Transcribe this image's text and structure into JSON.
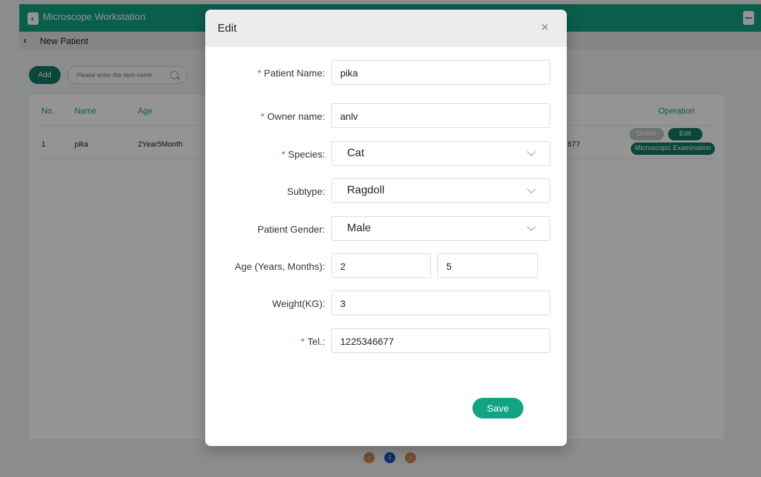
{
  "app": {
    "title": "Microscope Workstation",
    "breadcrumb": "New Patient"
  },
  "toolbar": {
    "add_label": "Add",
    "search_placeholder": "Please enter the item name"
  },
  "table": {
    "headers": {
      "no": "No.",
      "name": "Name",
      "age": "Age",
      "operation": "Operation"
    },
    "row": {
      "no": "1",
      "name": "pika",
      "age": "2Year5Month",
      "tel_partial": "677",
      "delete_label": "Delete",
      "edit_label": "Edit",
      "exam_label": "Microscopic Examination"
    }
  },
  "pagination": {
    "prev": "‹",
    "current": "1",
    "next": "›"
  },
  "modal": {
    "title": "Edit",
    "close_glyph": "×",
    "required_mark": "*",
    "labels": {
      "patient_name": "Patient Name:",
      "owner_name": "Owner name:",
      "species": "Species:",
      "subtype": "Subtype:",
      "gender": "Patient Gender:",
      "age": "Age (Years, Months):",
      "weight": "Weight(KG):",
      "tel": "Tel.:"
    },
    "values": {
      "patient_name": "pika",
      "owner_name": "anlv",
      "species": "Cat",
      "subtype": "Ragdoll",
      "gender": "Male",
      "age_years": "2",
      "age_months": "5",
      "weight": "3",
      "tel": "1225346677"
    },
    "save_label": "Save"
  },
  "colors": {
    "accent": "#12a384",
    "accent_dark": "#0e7a63",
    "required": "#e03b3b",
    "pager_inactive": "#c98a5a",
    "pager_active": "#1f4fb6"
  }
}
